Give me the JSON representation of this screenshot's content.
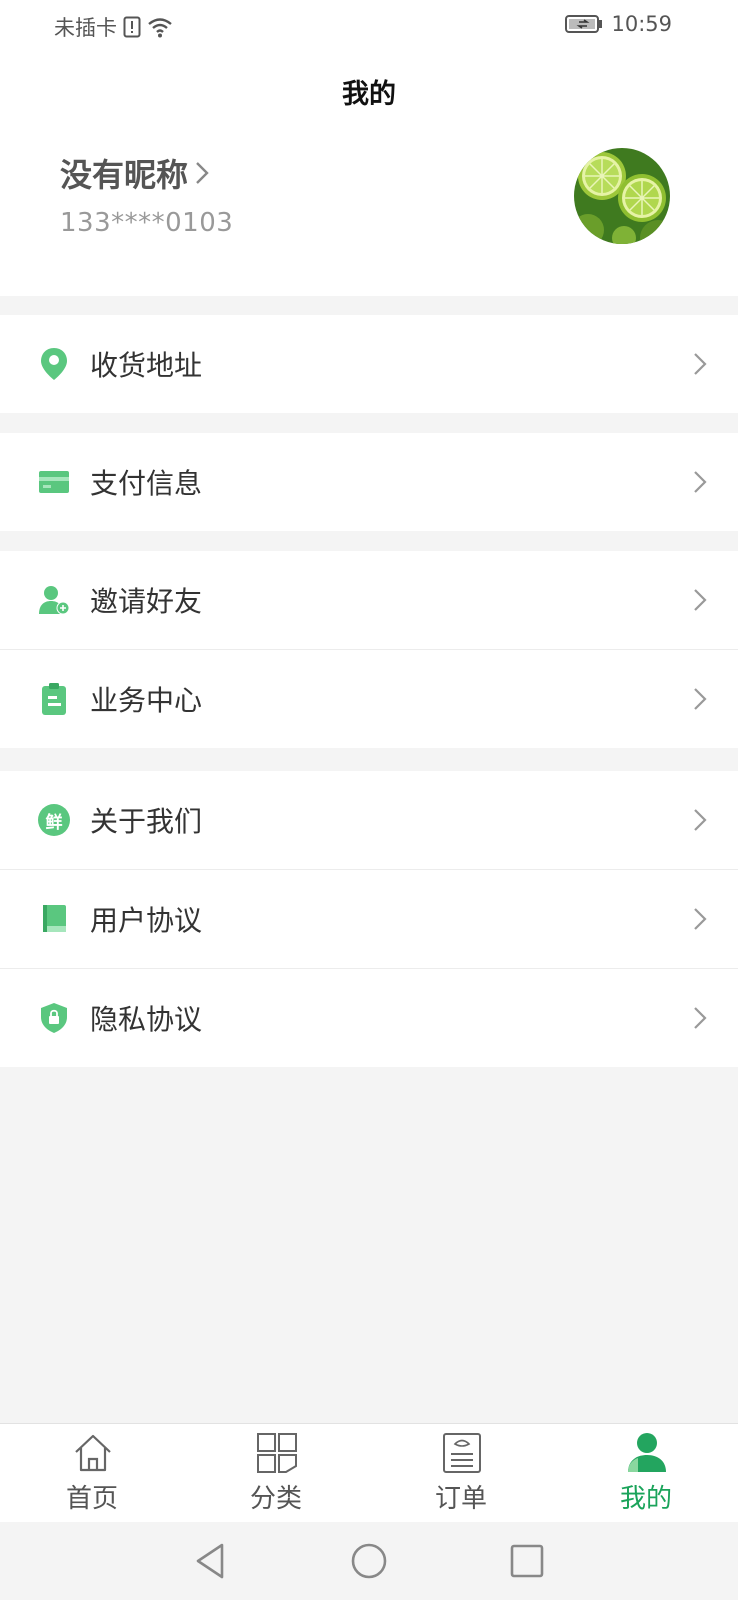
{
  "status_bar": {
    "carrier": "未插卡",
    "time": "10:59"
  },
  "header": {
    "title": "我的"
  },
  "profile": {
    "nickname": "没有昵称",
    "phone": "133****0103"
  },
  "menu_groups": [
    [
      {
        "icon": "location-pin-icon",
        "label": "收货地址"
      }
    ],
    [
      {
        "icon": "credit-card-icon",
        "label": "支付信息"
      }
    ],
    [
      {
        "icon": "add-user-icon",
        "label": "邀请好友"
      },
      {
        "icon": "clipboard-icon",
        "label": "业务中心"
      }
    ],
    [
      {
        "icon": "fresh-badge-icon",
        "label": "关于我们",
        "badge_text": "鲜"
      },
      {
        "icon": "book-icon",
        "label": "用户协议"
      },
      {
        "icon": "shield-lock-icon",
        "label": "隐私协议"
      }
    ]
  ],
  "tabbar": {
    "items": [
      {
        "icon": "home-icon",
        "label": "首页"
      },
      {
        "icon": "category-grid-icon",
        "label": "分类"
      },
      {
        "icon": "order-list-icon",
        "label": "订单"
      },
      {
        "icon": "profile-icon",
        "label": "我的",
        "active": true
      }
    ]
  },
  "colors": {
    "accent": "#1aa35a",
    "icon_green": "#5ac77f",
    "background": "#f4f4f4"
  }
}
